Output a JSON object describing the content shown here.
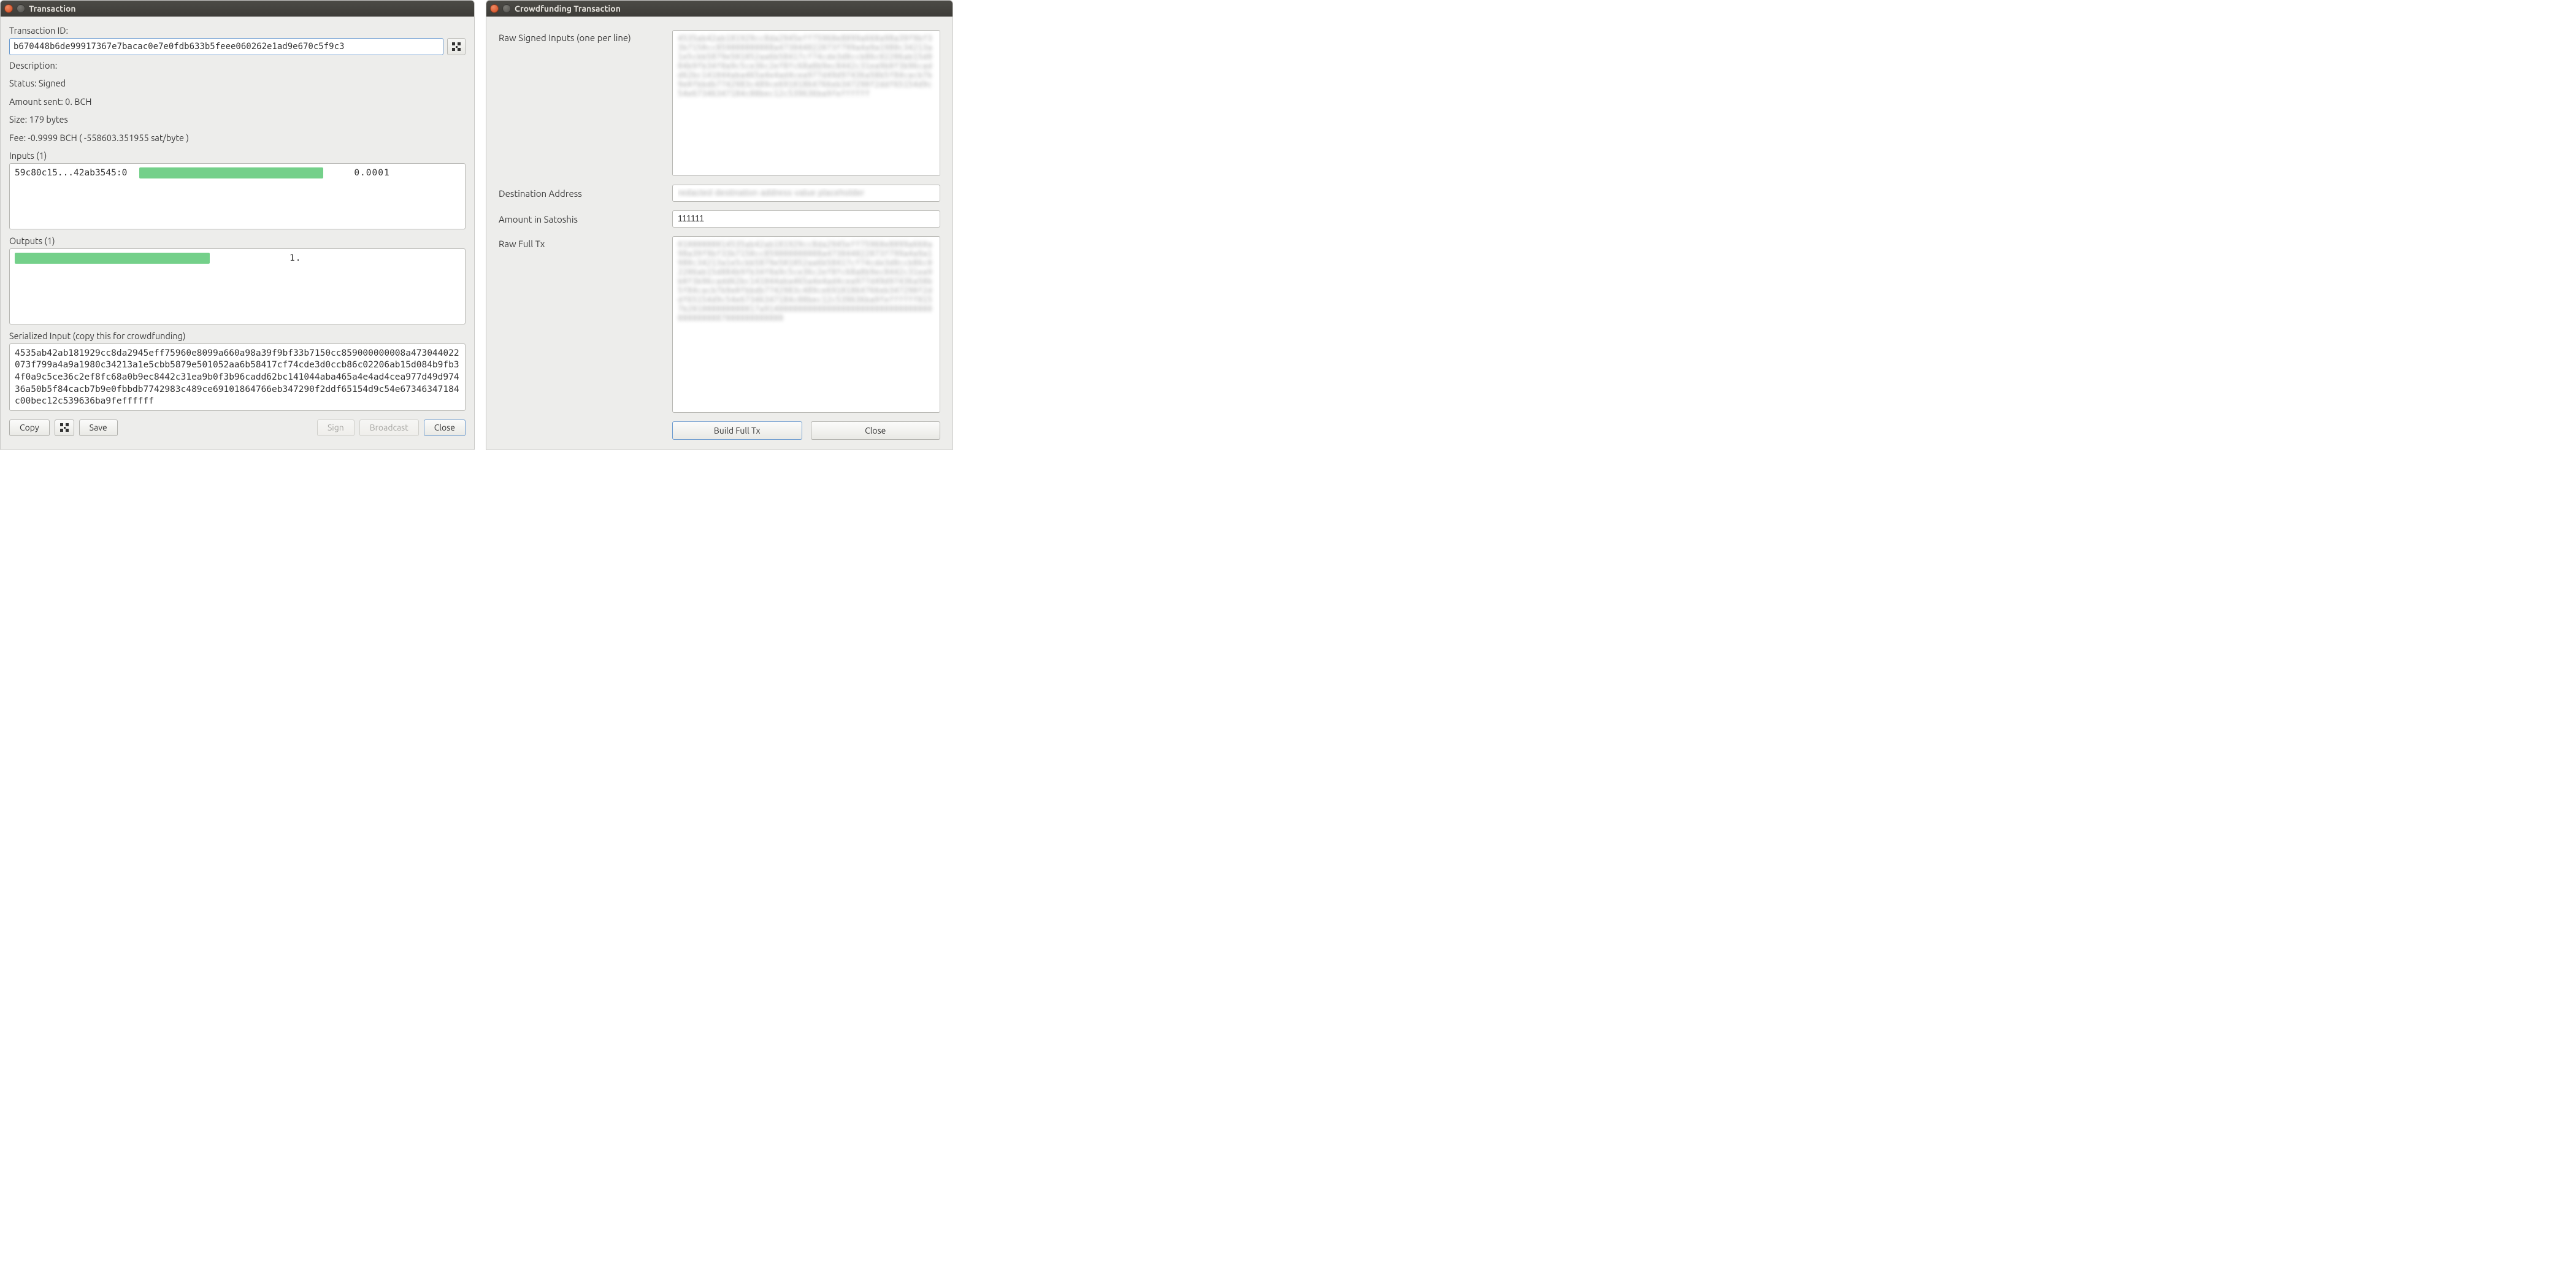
{
  "left": {
    "title": "Transaction",
    "labels": {
      "txid": "Transaction ID:",
      "description": "Description:",
      "status": "Status: Signed",
      "amount_sent": "Amount sent: 0. BCH",
      "size": "Size: 179 bytes",
      "fee": "Fee: -0.9999 BCH  ( -558603.351955 sat/byte )",
      "inputs": "Inputs (1)",
      "outputs": "Outputs (1)",
      "serialized": "Serialized Input (copy this for crowdfunding)"
    },
    "txid": "b670448b6de99917367e7bacac0e7e0fdb633b5feee060262e1ad9e670c5f9c3",
    "inputs_list": [
      {
        "outpoint": "59c80c15...42ab3545:0",
        "address_redacted": true,
        "amount": "0.0001"
      }
    ],
    "outputs_list": [
      {
        "address_redacted": true,
        "amount": "1."
      }
    ],
    "serialized_hex": "4535ab42ab181929cc8da2945eff75960e8099a660a98a39f9bf33b7150cc859000000008a473044022073f799a4a9a1980c34213a1e5cbb5879e501052aa6b58417cf74cde3d0ccb86c02206ab15d084b9fb34f0a9c5ce36c2ef8fc68a0b9ec8442c31ea9b0f3b96cadd62bc141044aba465a4e4ad4cea977d49d97436a50b5f84cacb7b9e0fbbdb7742983c489ce69101864766eb347290f2ddf65154d9c54e67346347184c00bec12c539636ba9feffffff",
    "buttons": {
      "copy": "Copy",
      "save": "Save",
      "sign": "Sign",
      "broadcast": "Broadcast",
      "close": "Close"
    }
  },
  "right": {
    "title": "Crowdfunding Transaction",
    "labels": {
      "raw_signed": "Raw Signed Inputs (one per line)",
      "dest_addr": "Destination Address",
      "amount_sats": "Amount in Satoshis",
      "raw_full": "Raw Full Tx"
    },
    "raw_signed_inputs_redacted": true,
    "destination_address_redacted": true,
    "amount_satoshis": "111111",
    "raw_full_tx_redacted": true,
    "buttons": {
      "build": "Build Full Tx",
      "close": "Close"
    }
  }
}
